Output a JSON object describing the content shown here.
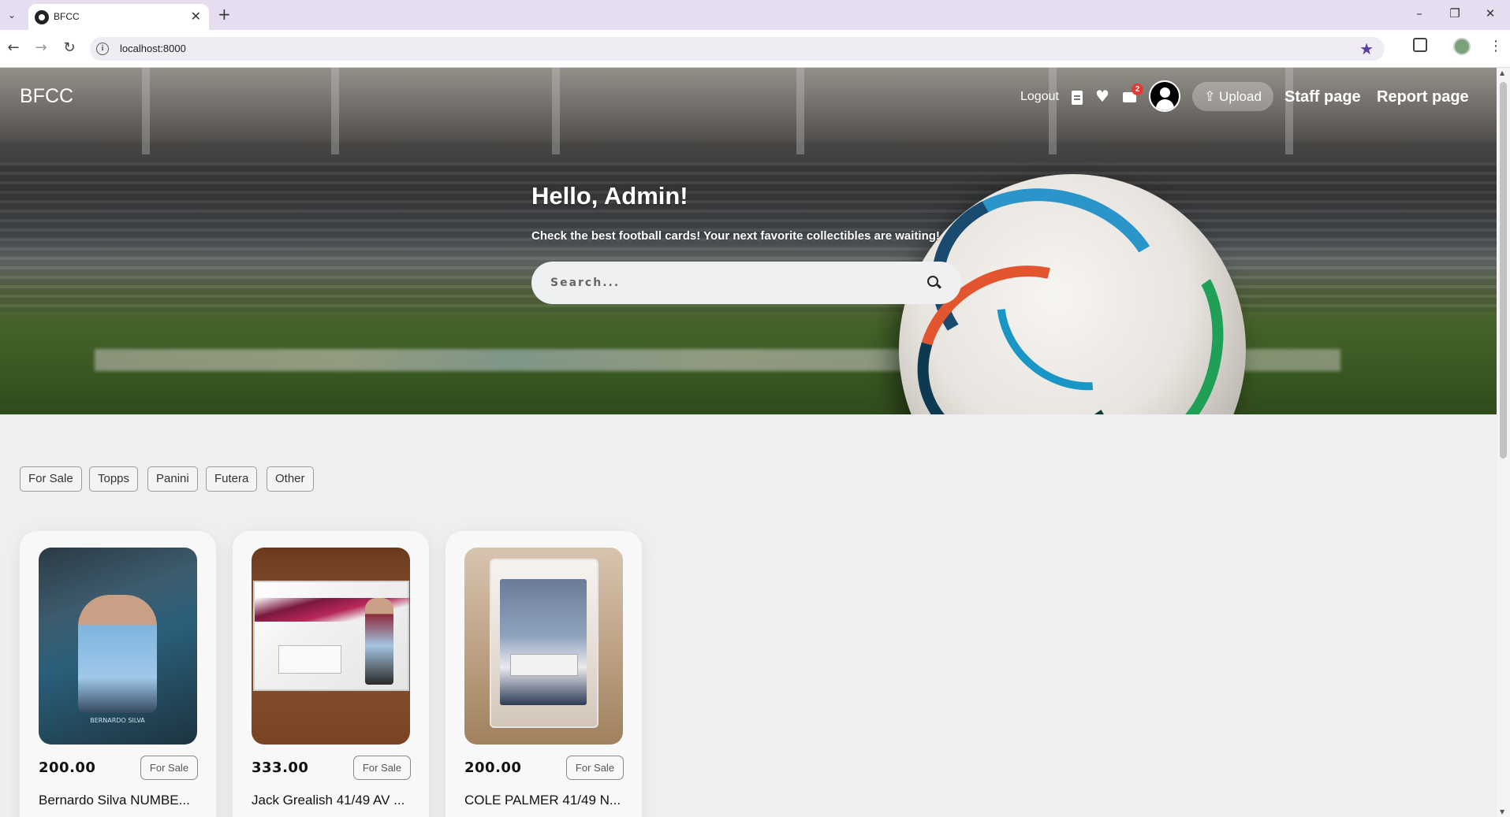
{
  "browser": {
    "tab_title": "BFCC",
    "url": "localhost:8000",
    "new_tab_symbol": "+",
    "close_symbol": "✕"
  },
  "nav": {
    "brand": "BFCC",
    "logout": "Logout",
    "mail_badge": "2",
    "upload": "⇪ Upload",
    "staff": "Staff page",
    "report": "Report page"
  },
  "hero": {
    "title": "Hello, Admin!",
    "subtitle": "Check the best football cards! Your next favorite collectibles are waiting!",
    "search_placeholder": "Search..."
  },
  "filters": [
    "For Sale",
    "Topps",
    "Panini",
    "Futera",
    "Other"
  ],
  "cards": [
    {
      "price": "200.00",
      "status": "For Sale",
      "title": "Bernardo Silva NUMBE...",
      "art_text": "BERNARDO SILVA"
    },
    {
      "price": "333.00",
      "status": "For Sale",
      "title": "Jack Grealish 41/49 AV ..."
    },
    {
      "price": "200.00",
      "status": "For Sale",
      "title": "COLE PALMER 41/49 N..."
    }
  ]
}
